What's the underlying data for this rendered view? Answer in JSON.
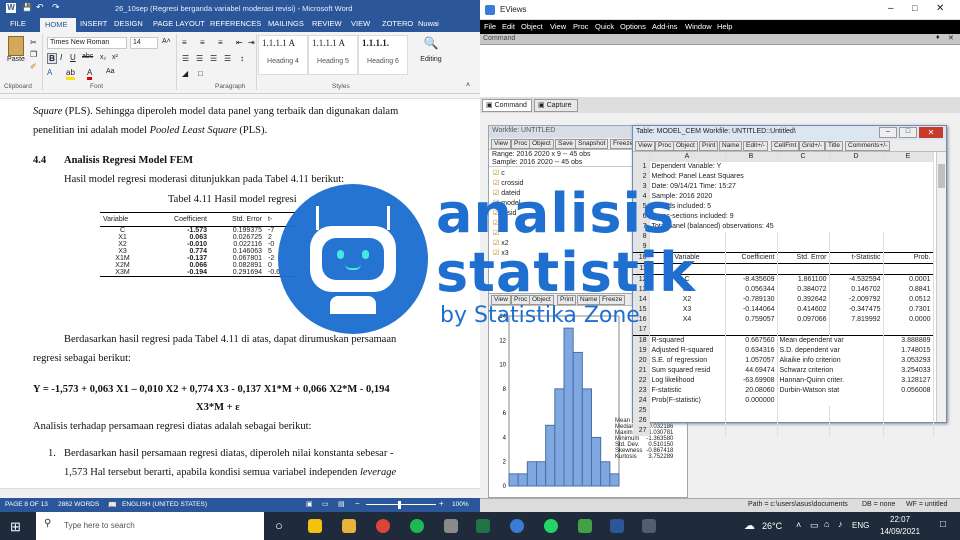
{
  "word": {
    "title": "26_10sep (Regresi berganda variabel moderasi revisi) - Microsoft Word",
    "tabs": [
      "FILE",
      "HOME",
      "INSERT",
      "DESIGN",
      "PAGE LAYOUT",
      "REFERENCES",
      "MAILINGS",
      "REVIEW",
      "VIEW",
      "ZOTERO",
      "Nuwai"
    ],
    "ribbon": {
      "paste": "Paste",
      "clipboard": "Clipboard",
      "font_name": "Times New Roman",
      "font_size": "14",
      "font_group": "Font",
      "paragraph_group": "Paragraph",
      "styles_group": "Styles",
      "editing": "Editing",
      "styles": [
        {
          "sample": "1.1.1.1 A",
          "name": "Heading 4"
        },
        {
          "sample": "1.1.1.1 A",
          "name": "Heading 5"
        },
        {
          "sample": "1.1.1.1.",
          "name": "Heading 6"
        }
      ]
    },
    "doc": {
      "line1_italic": "Square",
      "line1_rest": " (PLS). Sehingga diperoleh model data panel yang terbaik dan digunakan dalam",
      "line2_pre": "penelitian ini adalah model ",
      "line2_italic": "Pooled Least Square",
      "line2_post": " (PLS).",
      "section_num": "4.4",
      "section_title": "Analisis Regresi Model FEM",
      "intro": "Hasil model regresi moderasi ditunjukkan pada Tabel 4.11 berikut:",
      "table_caption": "Tabel 4.11 Hasil model regresi",
      "table_headers": [
        "Variable",
        "Coefficient",
        "Std. Error",
        "t-"
      ],
      "table_rows": [
        [
          "C",
          "-1.573",
          "0.199375",
          "-7"
        ],
        [
          "X1",
          "0.063",
          "0.026725",
          "2"
        ],
        [
          "X2",
          "-0.010",
          "0.022116",
          "-0"
        ],
        [
          "X3",
          "0.774",
          "0.146063",
          "5"
        ],
        [
          "X1M",
          "-0.137",
          "0.067801",
          "-2"
        ],
        [
          "X2M",
          "0.066",
          "0.082891",
          "0"
        ],
        [
          "X3M",
          "-0.194",
          "0.291694",
          "-0.6"
        ]
      ],
      "para2_a": "Berdasarkan hasil regresi pada Tabel 4.11 di atas, dapat dirumuskan persamaan",
      "para2_b": "regresi sebagai berikut:",
      "equation": "Y = -1,573 + 0,063 X1 – 0,010 X2 + 0,774 X3 - 0,137 X1*M + 0,066 X2*M - 0,194",
      "equation_2": "X3*M + ε",
      "analysis": "Analisis terhadap persamaan regresi diatas adalah sebagai berikut:",
      "list1_a": "Berdasarkan hasil persamaan regresi diatas, diperoleh nilai konstanta sebesar -",
      "list1_b_pre": "1,573 Hal tersebut berarti, apabila kondisi semua variabel independen ",
      "list1_b_italic": "leverage"
    },
    "status": {
      "page": "PAGE 8 OF 13",
      "words": "2862 WORDS",
      "lang": "ENGLISH (UNITED STATES)",
      "zoom": "100%"
    }
  },
  "eviews": {
    "title": "EViews",
    "menu": [
      "File",
      "Edit",
      "Object",
      "View",
      "Proc",
      "Quick",
      "Options",
      "Add-ins",
      "Window",
      "Help"
    ],
    "command_label": "Command",
    "tabs": [
      "Command",
      "Capture"
    ],
    "workfile": {
      "title": "Workfile: UNTITLED",
      "buttons": [
        "View",
        "Proc",
        "Object",
        "Save",
        "Snapshot",
        "Freeze"
      ],
      "range": "Range:  2016 2020 x 9   --  45 obs",
      "sample": "Sample: 2016 2020   --  45 obs",
      "items": [
        "c",
        "crossid",
        "dateid",
        "model",
        "resid",
        "",
        "",
        "x2",
        "x3"
      ]
    },
    "series_buttons": [
      "View",
      "Proc",
      "Object",
      "Print",
      "Name",
      "Freeze"
    ],
    "hist_stats": [
      [
        "Mean",
        "-1.36e-16"
      ],
      [
        "Median",
        "0.032186"
      ],
      [
        "Maximum",
        "1.030781"
      ],
      [
        "Minimum",
        "-1.363580"
      ],
      [
        "Std. Dev.",
        "0.510150"
      ],
      [
        "Skewness",
        "-0.867418"
      ],
      [
        "Kurtosis",
        "3.752289"
      ]
    ],
    "hist_y_ticks": [
      "14",
      "12",
      "10",
      "8",
      "6",
      "4",
      "2",
      "0"
    ],
    "table": {
      "title": "Table: MODEL_CEM   Workfile: UNTITLED::Untitled\\",
      "buttons": [
        "View",
        "Proc",
        "Object",
        "Print",
        "Name",
        "Edit+/-",
        "CellFmt",
        "Grid+/-",
        "Title",
        "Comments+/-"
      ],
      "col_headers": [
        "A",
        "B",
        "C",
        "D",
        "E"
      ],
      "header_lines": [
        "Dependent Variable: Y",
        "Method: Panel Least Squares",
        "Date: 09/14/21   Time: 15:27",
        "Sample: 2016 2020",
        "Periods included: 5",
        "Cross-sections included: 9",
        "Total panel (balanced) observations: 45"
      ],
      "coef_headers": [
        "Variable",
        "Coefficient",
        "Std. Error",
        "t-Statistic",
        "Prob."
      ],
      "coef_rows": [
        [
          "C",
          "-8.435609",
          "1.861100",
          "-4.532594",
          "0.0001"
        ],
        [
          "X1",
          "0.056344",
          "0.384072",
          "0.146702",
          "0.8841"
        ],
        [
          "X2",
          "-0.789130",
          "0.392642",
          "-2.009792",
          "0.0512"
        ],
        [
          "X3",
          "-0.144064",
          "0.414602",
          "-0.347475",
          "0.7301"
        ],
        [
          "X4",
          "0.759057",
          "0.097066",
          "7.819992",
          "0.0000"
        ]
      ],
      "stats_rows": [
        [
          "R-squared",
          "0.667560",
          "Mean dependent var",
          "3.888889"
        ],
        [
          "Adjusted R-squared",
          "0.634316",
          "S.D. dependent var",
          "1.748015"
        ],
        [
          "S.E. of regression",
          "1.057057",
          "Akaike info criterion",
          "3.053293"
        ],
        [
          "Sum squared resid",
          "44.69474",
          "Schwarz criterion",
          "3.254033"
        ],
        [
          "Log likelihood",
          "-63.69908",
          "Hannan-Quinn criter.",
          "3.128127"
        ],
        [
          "F-statistic",
          "20.08060",
          "Durbin-Watson stat",
          "0.056008"
        ],
        [
          "Prob(F-statistic)",
          "0.000000",
          "",
          ""
        ]
      ],
      "row_numbers": [
        "1",
        "2",
        "3",
        "4",
        "5",
        "6",
        "7",
        "8",
        "9",
        "10",
        "11",
        "12",
        "13",
        "14",
        "15",
        "16",
        "17",
        "18",
        "19",
        "20",
        "21",
        "22",
        "23",
        "24",
        "25",
        "26",
        "27"
      ]
    },
    "status": {
      "path": "Path = c:\\users\\asus\\documents",
      "db": "DB = none",
      "wf": "WF = untitled"
    }
  },
  "watermark": {
    "line1": "analisis",
    "line2": "statistik",
    "line3": "by Statistika Zone"
  },
  "taskbar": {
    "search": "Type here to search",
    "temp": "26°C",
    "lang": "ENG",
    "time": "22:07",
    "date": "14/09/2021"
  },
  "colors": {
    "word_blue": "#2b579a",
    "watermark_blue": "#1e6fd0",
    "taskbar": "#1f2b3a"
  }
}
